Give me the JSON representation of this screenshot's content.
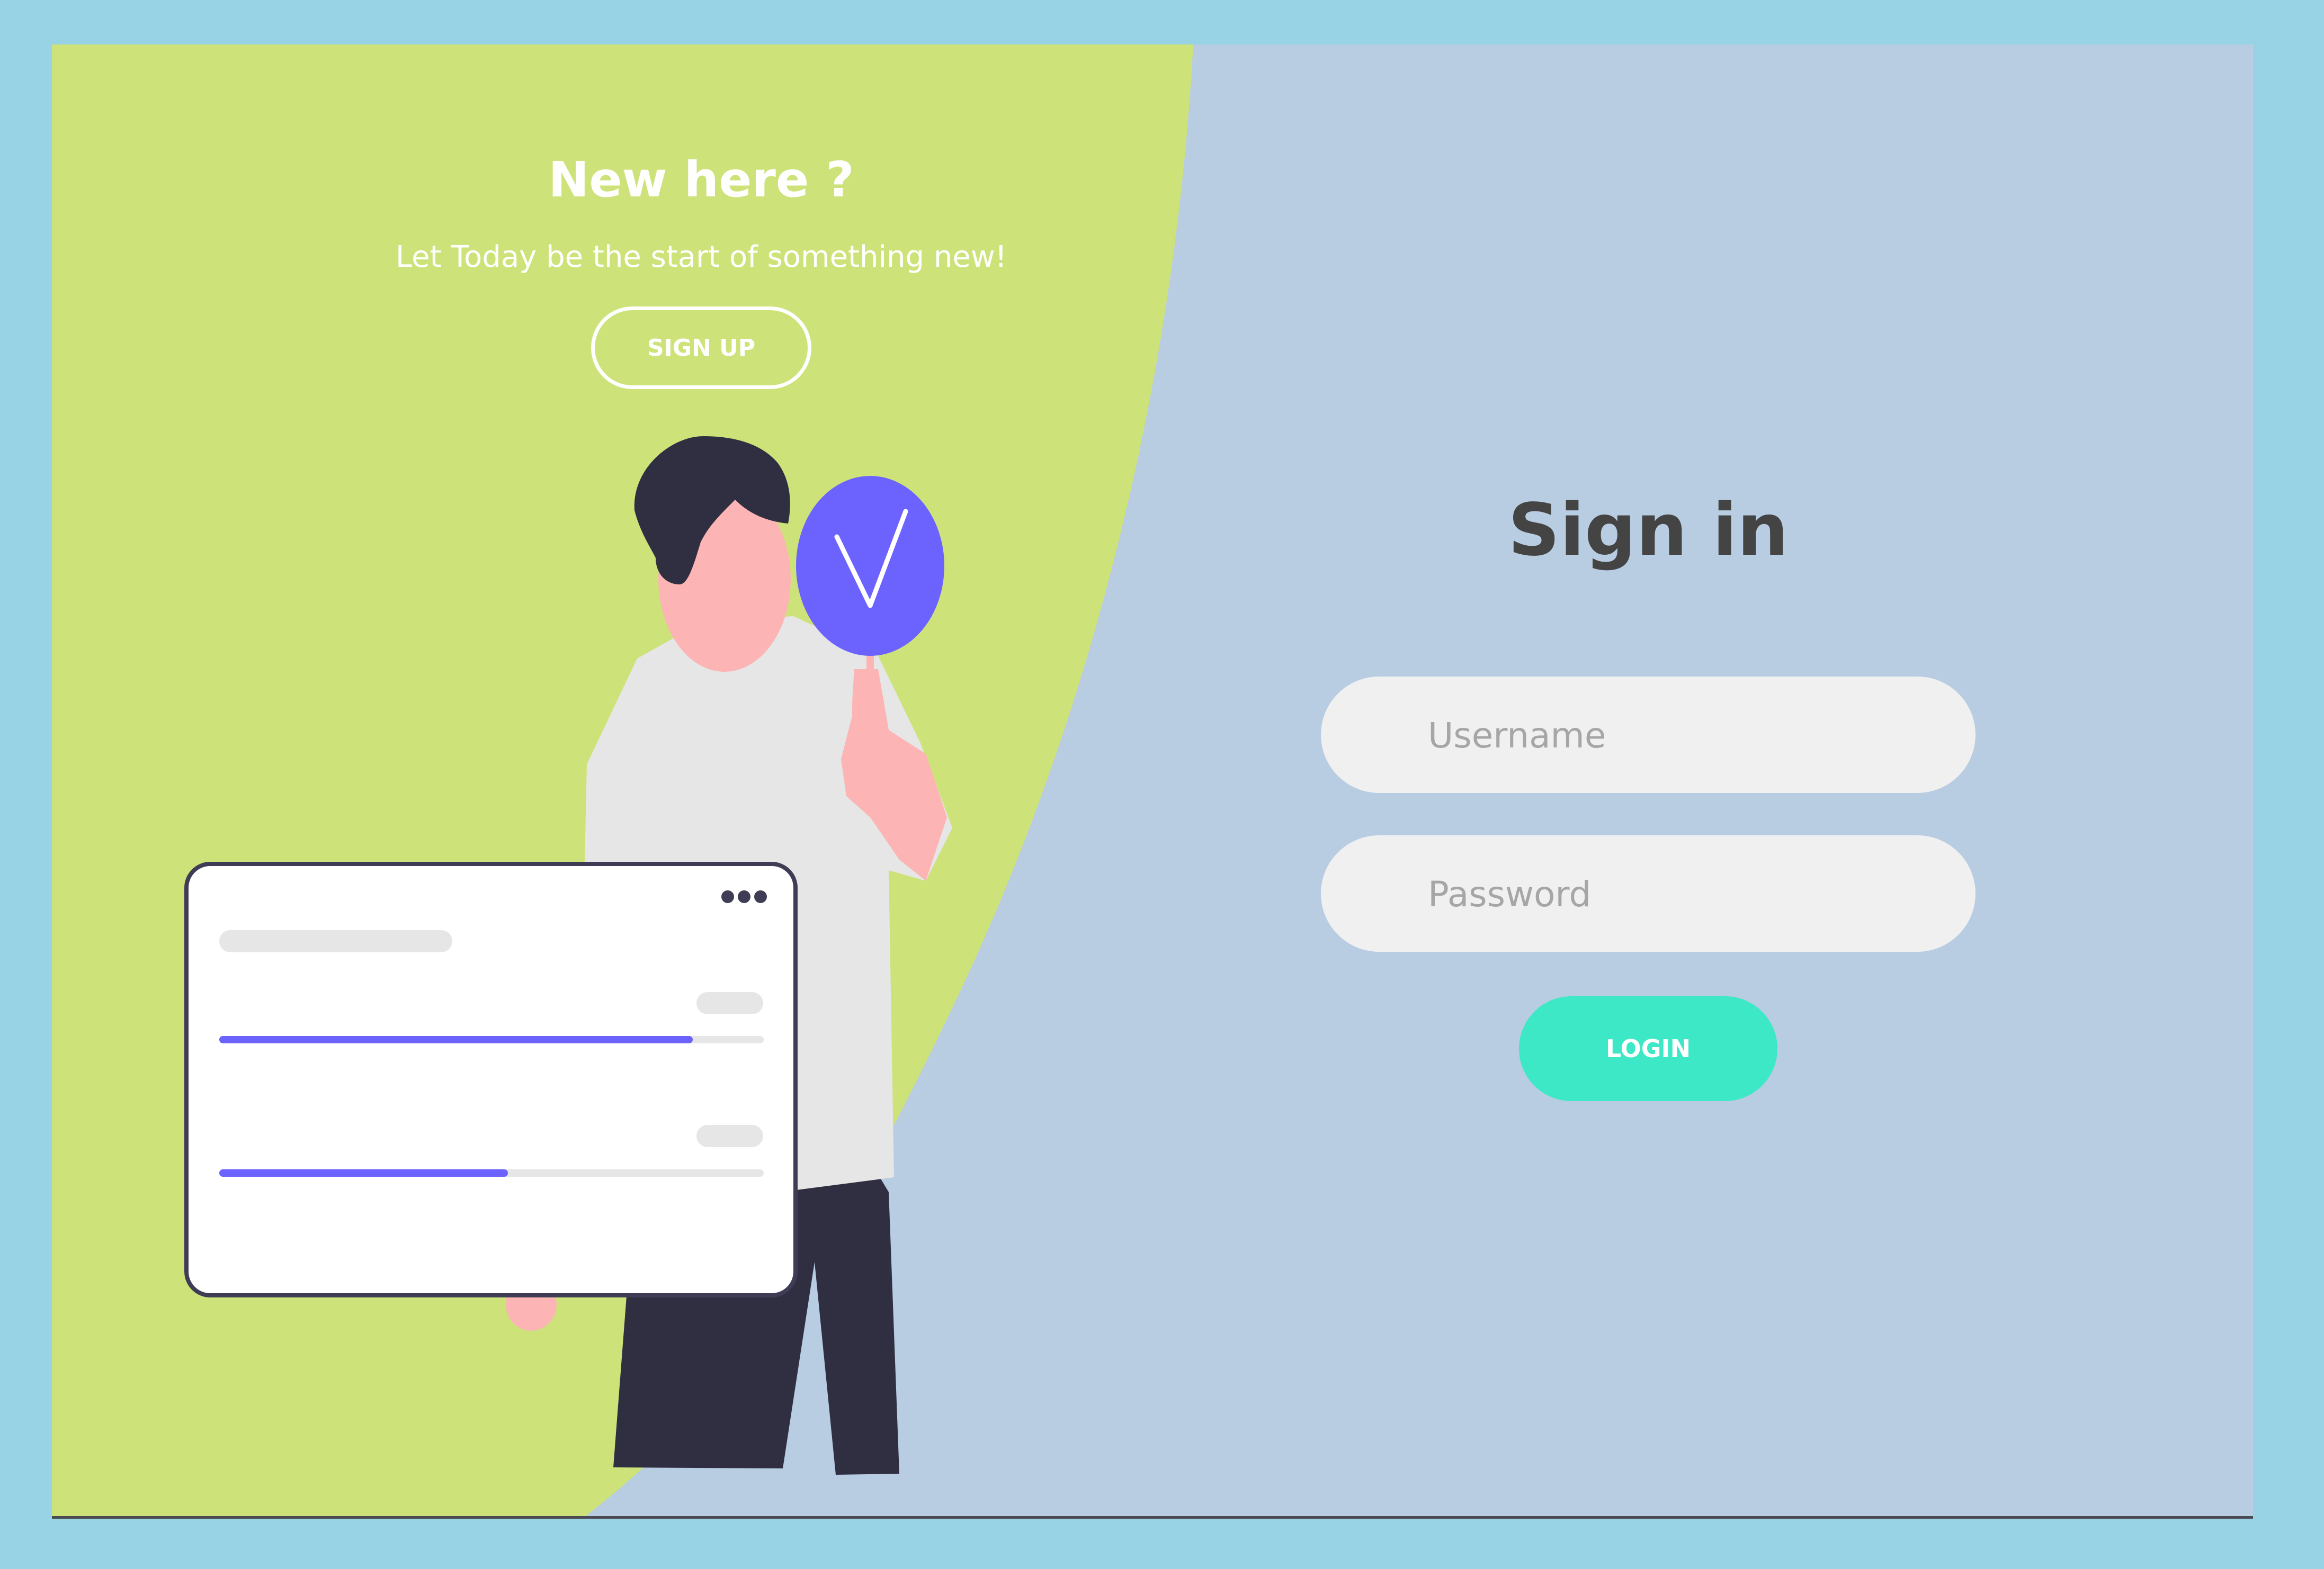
{
  "colors": {
    "outer_background": "#97d3e4",
    "right_panel": "#b8cce2",
    "left_panel": "#cde37a",
    "login_button": "#3de8c6",
    "accent_purple": "#6c63ff",
    "title_text": "#444444",
    "input_background": "#f0f0f0"
  },
  "left_panel": {
    "title": "New here ?",
    "subtitle": "Let Today be the start of something new!",
    "signup_label": "SIGN UP"
  },
  "illustration": {
    "description_icon": "person-holding-checkmark-sign",
    "card_menu_icon": "more-horizontal-icon",
    "progress_bars": [
      0.87,
      0.53
    ]
  },
  "signin": {
    "title": "Sign in",
    "username": {
      "placeholder": "Username",
      "value": ""
    },
    "password": {
      "placeholder": "Password",
      "value": ""
    },
    "login_label": "LOGIN"
  }
}
